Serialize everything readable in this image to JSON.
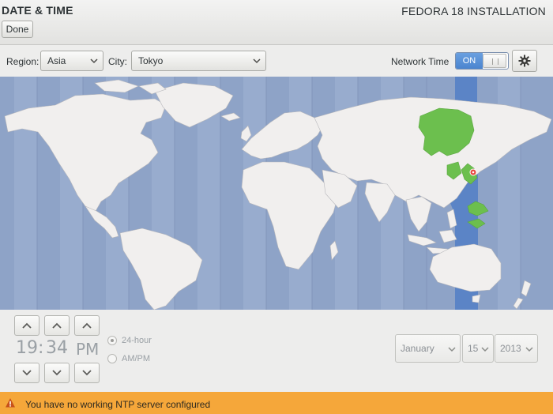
{
  "header": {
    "title": "DATE & TIME",
    "install_title": "FEDORA 18 INSTALLATION",
    "done_label": "Done"
  },
  "toolbar": {
    "region_label": "Region:",
    "region_value": "Asia",
    "city_label": "City:",
    "city_value": "Tokyo",
    "network_time_label": "Network Time",
    "network_time_state": "ON",
    "settings_icon": "gear-icon"
  },
  "map": {
    "selected_timezone_color": "#6cbf4e",
    "highlight_band_color": "#5b84c6",
    "ocean_color": "#8ea3c7",
    "land_color": "#f1efee",
    "city_marker": "Tokyo"
  },
  "time": {
    "hours": "19",
    "separator": ":",
    "minutes": "34",
    "period": "PM",
    "up_icon": "chevron-up-icon",
    "down_icon": "chevron-down-icon"
  },
  "format": {
    "option_24h": "24-hour",
    "option_ampm": "AM/PM",
    "selected": "24-hour"
  },
  "date": {
    "month": "January",
    "day": "15",
    "year": "2013"
  },
  "warning": {
    "icon": "warning-icon",
    "message": "You have no working NTP server configured",
    "color": "#f5a73a"
  }
}
